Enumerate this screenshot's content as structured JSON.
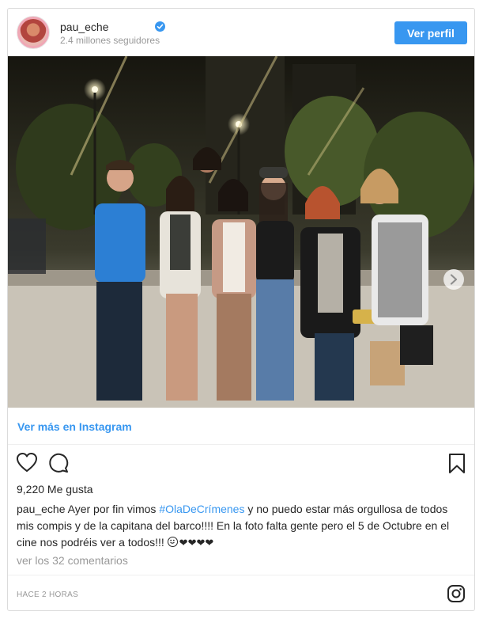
{
  "post": {
    "username": "pau_eche",
    "followers": "2.4 millones seguidores",
    "view_profile_label": "Ver perfil",
    "more_link": "Ver más en Instagram",
    "likes": "9,220 Me gusta",
    "caption": {
      "user": "pau_eche",
      "text_before": " Ayer por fin vimos ",
      "hashtag": "#OlaDeCrímenes",
      "text_after": " y no puedo estar más orgullosa de todos mis compis y de la capitana del barco!!!! En la foto falta gente pero el 5 de Octubre en el cine nos podréis ver a todos!!! ",
      "hearts": "❤❤❤❤"
    },
    "comments_link": "ver los 32 comentarios",
    "timestamp": "HACE 2 HORAS"
  },
  "icons": {
    "verified": "verified-badge-icon",
    "heart": "heart-icon",
    "comment": "comment-icon",
    "save": "bookmark-icon",
    "next": "chevron-right-icon",
    "instagram": "instagram-icon"
  },
  "colors": {
    "accent": "#3897f0",
    "text": "#262626",
    "muted": "#999999",
    "border": "#dbdbdb"
  }
}
